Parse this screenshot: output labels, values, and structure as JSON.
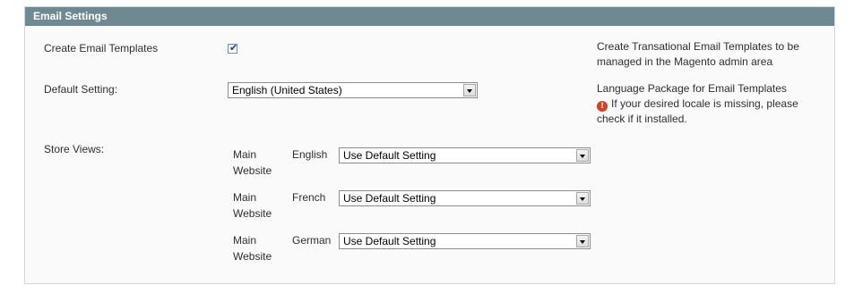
{
  "section": {
    "title": "Email Settings"
  },
  "create_templates": {
    "label": "Create Email Templates",
    "checked": true,
    "note": "Create Transational Email Templates to be managed in the Magento admin area"
  },
  "default_setting": {
    "label": "Default Setting:",
    "value": "English (United States)",
    "note_title": "Language Package for Email Templates",
    "warning": "If your desired locale is missing, please check if it installed.",
    "warning_icon": "exclamation-icon"
  },
  "store_views": {
    "label": "Store Views:",
    "rows": [
      {
        "website": "Main Website",
        "language": "English",
        "value": "Use Default Setting"
      },
      {
        "website": "Main Website",
        "language": "French",
        "value": "Use Default Setting"
      },
      {
        "website": "Main Website",
        "language": "German",
        "value": "Use Default Setting"
      }
    ]
  },
  "colors": {
    "header_bg": "#6f8992",
    "warning": "#d9411e"
  }
}
